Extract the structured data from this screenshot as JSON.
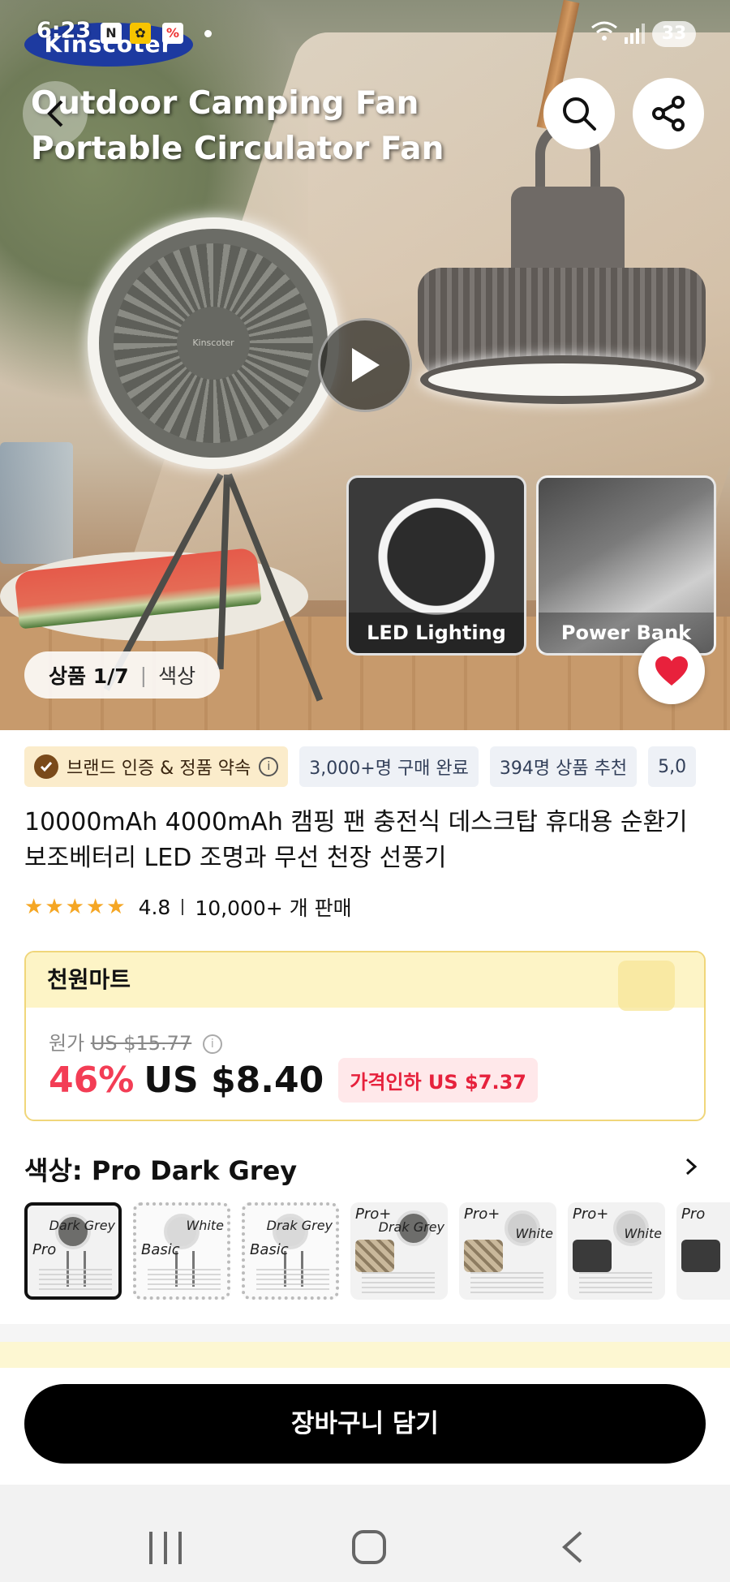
{
  "status_bar": {
    "time": "6:23",
    "battery": "33"
  },
  "hero": {
    "brand_logo": "Kinscoter",
    "title_line1": "Outdoor Camping Fan",
    "title_line2": "Portable Circulator Fan",
    "fan_logo": "Kinscoter",
    "thumbnails": [
      {
        "caption": "LED Lighting"
      },
      {
        "caption": "Power Bank"
      }
    ],
    "counter": {
      "index": "상품 1/7",
      "color_label": "색상"
    }
  },
  "chips": [
    {
      "label": "브랜드 인증 & 정품 약속"
    },
    {
      "label": "3,000+명 구매 완료"
    },
    {
      "label": "394명 상품 추천"
    },
    {
      "label": "5,0"
    }
  ],
  "product": {
    "title": "10000mAh 4000mAh 캠핑 팬 충전식 데스크탑 휴대용 순환기 보조베터리 LED 조명과 무선 천장 선풍기",
    "rating": "4.8",
    "rating_stars": 5,
    "sold": "10,000+ 개 판매"
  },
  "price": {
    "store": "천원마트",
    "orig_label": "원가",
    "orig_price": "US $15.77",
    "discount": "46%",
    "current": "US $8.40",
    "cut_label": "가격인하 US $7.37"
  },
  "color": {
    "label": "색상: Pro Dark Grey",
    "options": [
      {
        "top": "Dark Grey",
        "left": "Pro",
        "style": "selected"
      },
      {
        "top": "White",
        "left": "Basic",
        "style": "dashed"
      },
      {
        "top": "Drak Grey",
        "left": "Basic",
        "style": "dashed"
      },
      {
        "top": "Pro+",
        "right": "Drak Grey",
        "style": "camo"
      },
      {
        "top": "Pro+",
        "right": "White",
        "style": "camo"
      },
      {
        "top": "Pro+",
        "right": "White",
        "style": "dark"
      },
      {
        "top": "Pro",
        "right": "",
        "style": "dark"
      }
    ]
  },
  "cart_button": "장바구니 담기",
  "colors": {
    "accent_red": "#f33d55",
    "heart": "#e8213c",
    "price_border": "#f0d67a"
  }
}
